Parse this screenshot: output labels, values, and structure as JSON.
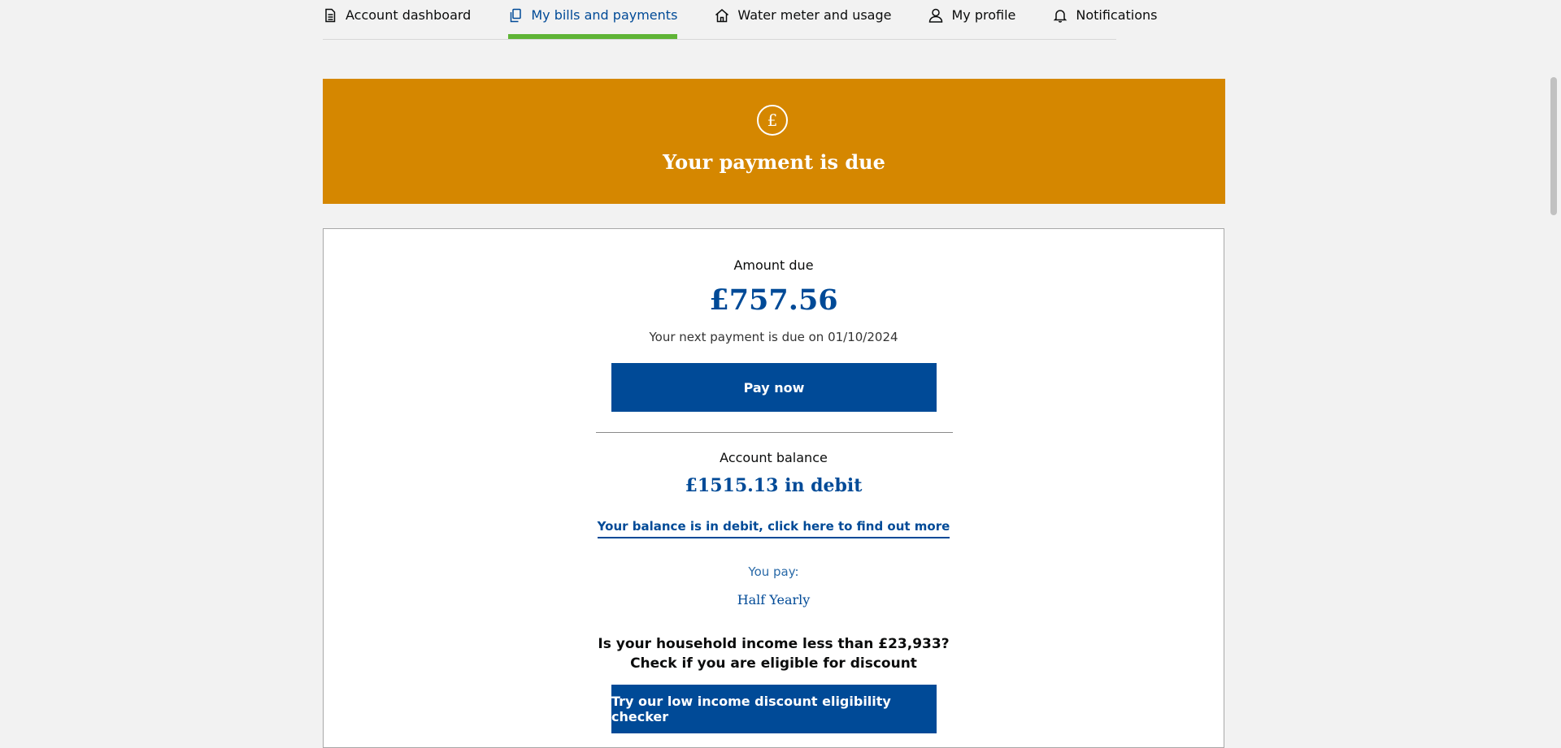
{
  "nav": {
    "items": [
      {
        "label": "Account dashboard",
        "icon": "document-icon"
      },
      {
        "label": "My bills and payments",
        "icon": "copy-icon",
        "active": true
      },
      {
        "label": "Water meter and usage",
        "icon": "home-icon"
      },
      {
        "label": "My profile",
        "icon": "user-icon"
      },
      {
        "label": "Notifications",
        "icon": "bell-icon"
      }
    ]
  },
  "banner": {
    "icon_symbol": "£",
    "title": "Your payment is due",
    "color": "#d58700"
  },
  "payment": {
    "amount_label": "Amount due",
    "amount": "£757.56",
    "due_text": "Your next payment is due on 01/10/2024",
    "pay_button": "Pay now"
  },
  "balance": {
    "label": "Account balance",
    "value": "£1515.13 in debit",
    "link": "Your balance is in debit, click here to find out more",
    "you_pay_label": "You pay:",
    "you_pay_value": "Half Yearly"
  },
  "discount": {
    "question_line1": "Is your household income less than £23,933?",
    "question_line2": "Check if you are eligible for discount",
    "button": "Try our low income discount eligibility checker"
  },
  "colors": {
    "primary": "#004a97",
    "active_tab": "#5fb436",
    "banner": "#d58700"
  }
}
